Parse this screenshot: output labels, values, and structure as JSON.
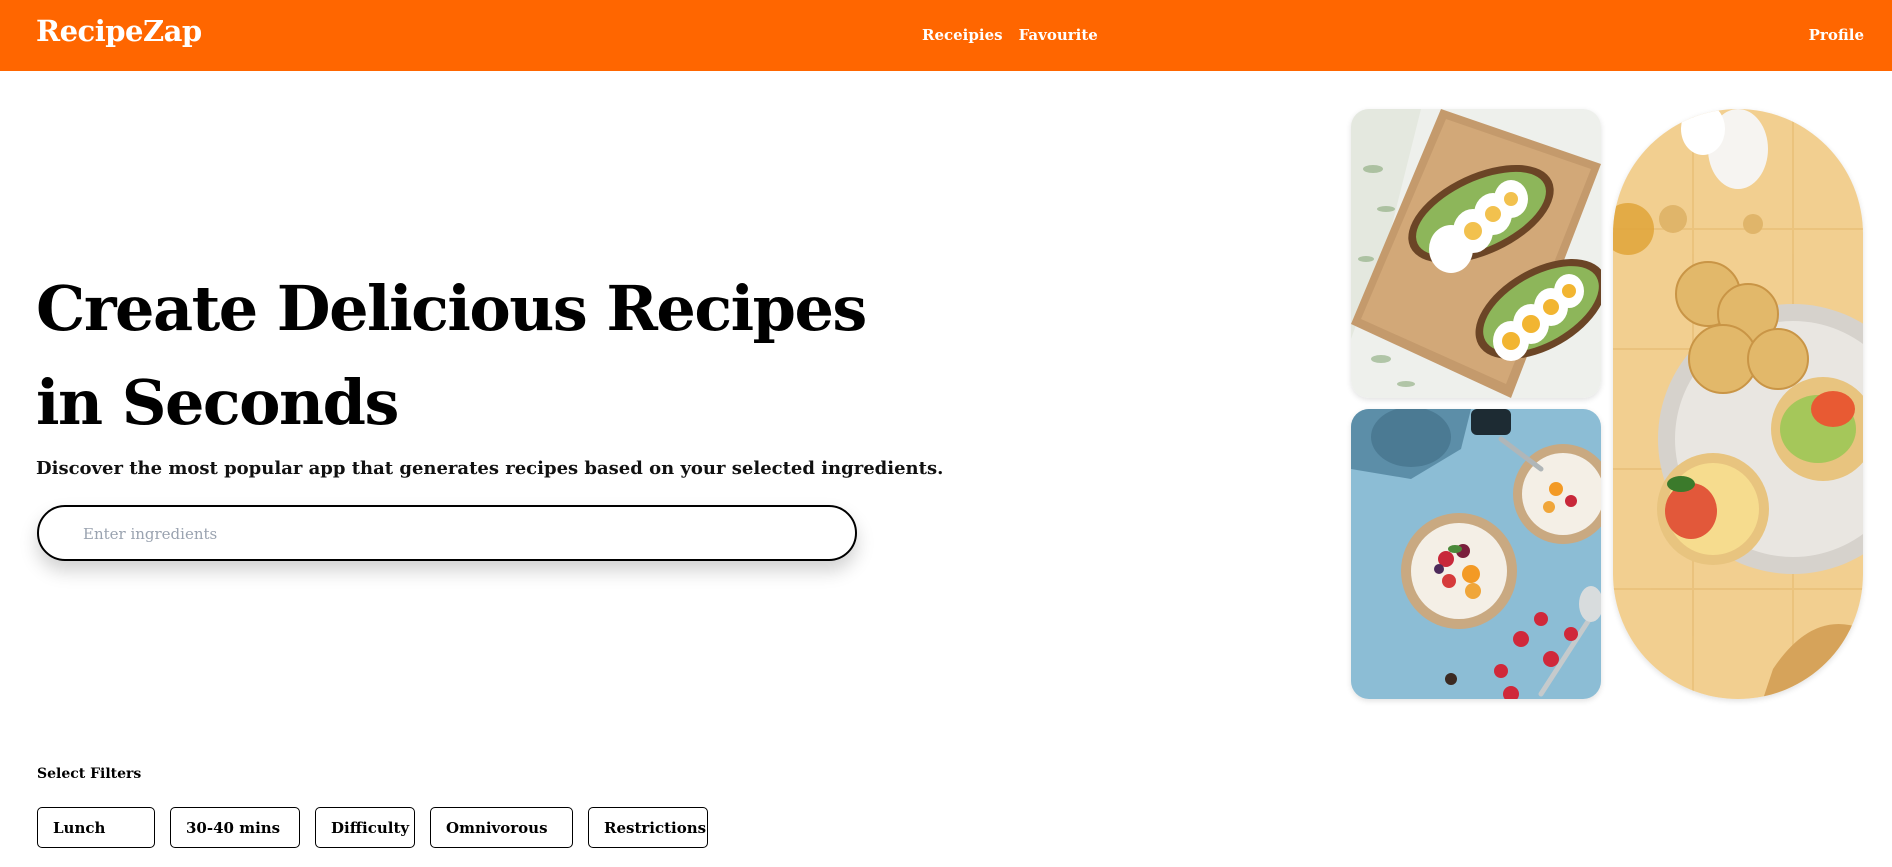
{
  "header": {
    "brand": "RecipeZap",
    "nav": [
      "Receipies",
      "Favourite"
    ],
    "profile": "Profile",
    "bg_color": "#ff6600"
  },
  "hero": {
    "title": "Create Delicious Recipes in Seconds",
    "subtitle": "Discover the most popular app that generates recipes based on your selected ingredients.",
    "search": {
      "placeholder": "Enter ingredients",
      "value": ""
    }
  },
  "filters": {
    "label": "Select Filters",
    "items": [
      "Lunch",
      "30-40 mins",
      "Difficulty",
      "Omnivorous",
      "Restrictions"
    ]
  }
}
